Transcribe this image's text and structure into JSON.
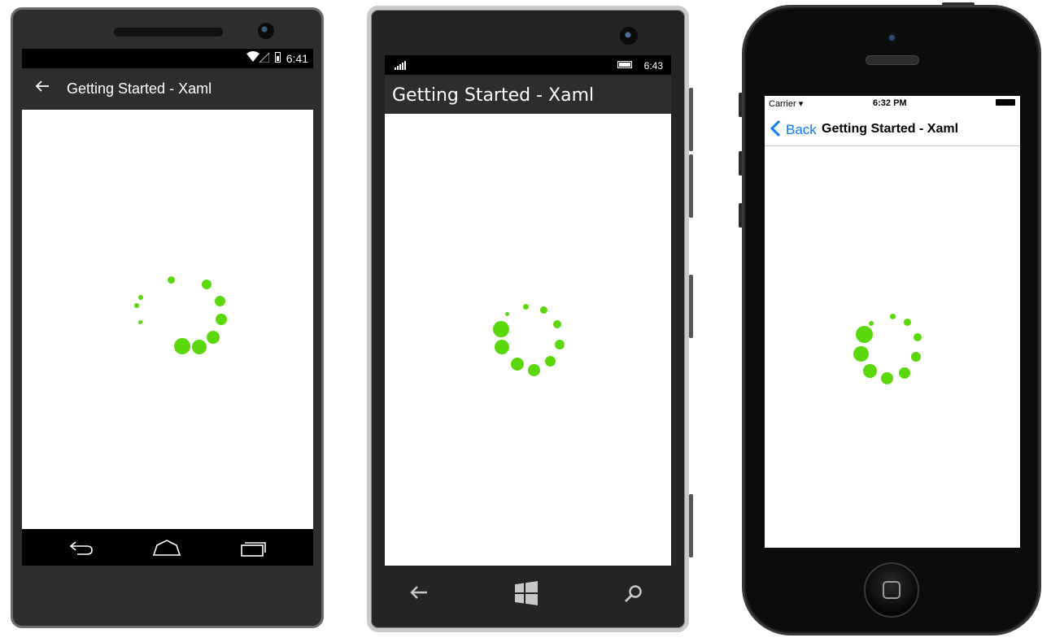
{
  "accent": "#5bd80b",
  "android": {
    "status_time": "6:41",
    "title": "Getting Started - Xaml",
    "icons": [
      "wifi-icon",
      "signal-icon",
      "battery-icon",
      "back-arrow-icon",
      "nav-back-icon",
      "nav-home-icon",
      "nav-recent-apps-icon"
    ]
  },
  "windows": {
    "status_time": "6:43",
    "title": "Getting Started - Xaml",
    "icons": [
      "signal-icon",
      "battery-icon",
      "back-icon",
      "windows-start-icon",
      "search-icon"
    ]
  },
  "ios": {
    "carrier": "Carrier",
    "status_time": "6:32 PM",
    "back_label": "Back",
    "title": "Getting Started - Xaml",
    "icons": [
      "wifi-icon",
      "battery-icon",
      "back-chevron-icon"
    ]
  }
}
